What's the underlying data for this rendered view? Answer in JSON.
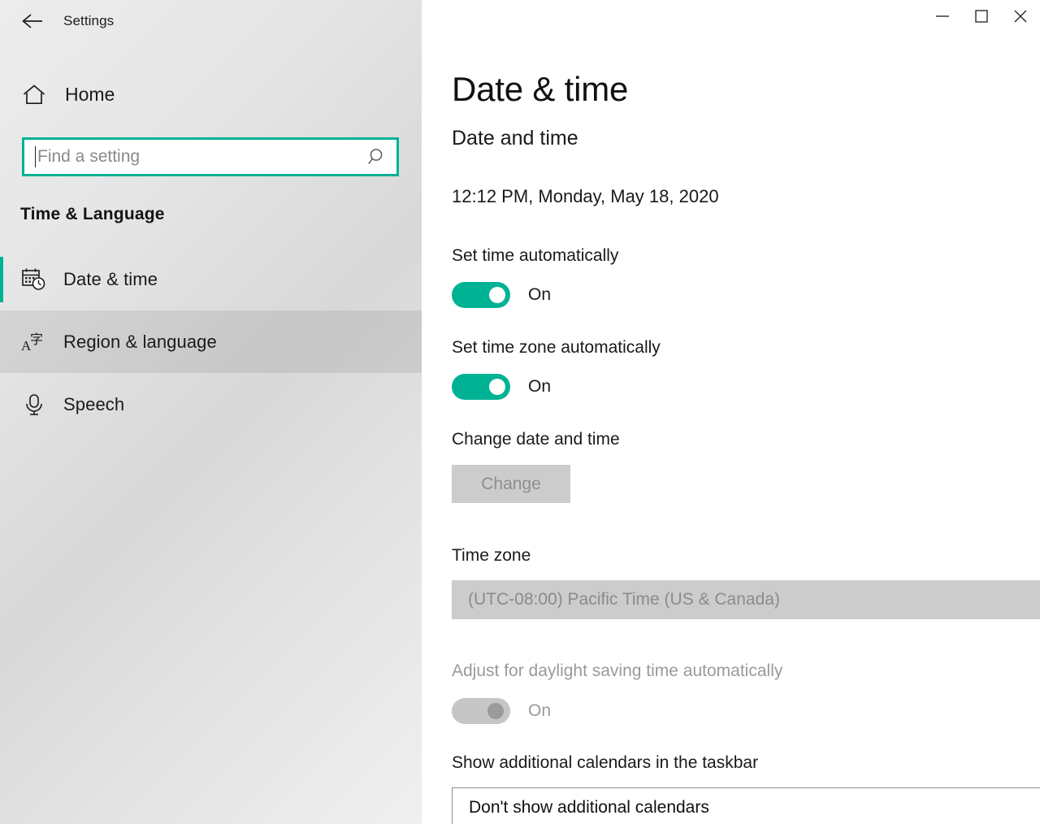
{
  "window": {
    "app_title": "Settings",
    "back_icon": "back-arrow-icon",
    "controls": {
      "minimize": "minimize-icon",
      "maximize": "maximize-icon",
      "close": "close-icon"
    }
  },
  "sidebar": {
    "home": {
      "label": "Home",
      "icon": "home-icon"
    },
    "search": {
      "placeholder": "Find a setting",
      "value": "",
      "icon": "search-icon"
    },
    "section_header": "Time & Language",
    "items": [
      {
        "label": "Date & time",
        "icon": "calendar-clock-icon",
        "selected": true,
        "hovered": false
      },
      {
        "label": "Region & language",
        "icon": "language-icon",
        "selected": false,
        "hovered": true
      },
      {
        "label": "Speech",
        "icon": "microphone-icon",
        "selected": false,
        "hovered": false
      }
    ]
  },
  "main": {
    "title": "Date & time",
    "subtitle": "Date and time",
    "current_datetime": "12:12 PM, Monday, May 18, 2020",
    "set_time_automatically": {
      "label": "Set time automatically",
      "state_text": "On",
      "enabled": true,
      "on": true
    },
    "set_timezone_automatically": {
      "label": "Set time zone automatically",
      "state_text": "On",
      "enabled": true,
      "on": true
    },
    "change_date_time": {
      "label": "Change date and time",
      "button_label": "Change",
      "enabled": false
    },
    "time_zone": {
      "label": "Time zone",
      "value": "(UTC-08:00) Pacific Time (US & Canada)",
      "enabled": false,
      "chevron": "chevron-down-icon"
    },
    "daylight_saving": {
      "label": "Adjust for daylight saving time automatically",
      "state_text": "On",
      "enabled": false,
      "on": true
    },
    "additional_calendars": {
      "label": "Show additional calendars in the taskbar",
      "value": "Don't show additional calendars",
      "enabled": true,
      "chevron": "chevron-down-icon"
    }
  },
  "colors": {
    "accent": "#00b294",
    "sidebar_hover": "rgba(0,0,0,0.078)",
    "disabled_control": "#cccccc",
    "disabled_text": "#8e8e8e"
  }
}
